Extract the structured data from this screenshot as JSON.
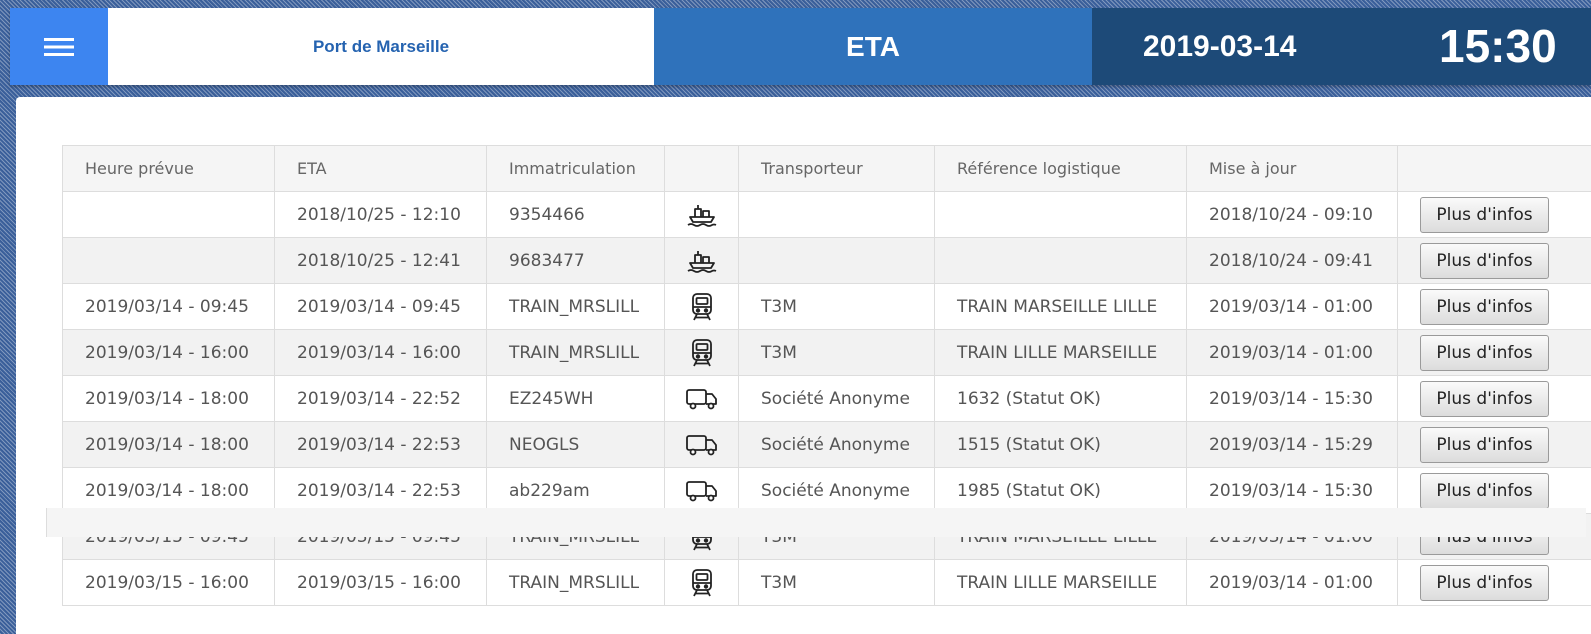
{
  "header": {
    "menu_icon": "hamburger-menu-icon",
    "site_name": "Port de Marseille",
    "module_title": "ETA",
    "date": "2019-03-14",
    "time": "15:30",
    "colors": {
      "menu": "#3d85f0",
      "module": "#2f72bb",
      "date": "#1d4a78"
    }
  },
  "table": {
    "columns": [
      "Heure prévue",
      "ETA",
      "Immatriculation",
      "",
      "Transporteur",
      "Référence logistique",
      "Mise à jour",
      ""
    ],
    "rows": [
      {
        "scheduled": "",
        "eta": "2018/10/25 - 12:10",
        "registration": "9354466",
        "icon": "ship-icon",
        "carrier": "",
        "reference": "",
        "updated": "2018/10/24 - 09:10",
        "button": "Plus d'infos"
      },
      {
        "scheduled": "",
        "eta": "2018/10/25 - 12:41",
        "registration": "9683477",
        "icon": "ship-icon",
        "carrier": "",
        "reference": "",
        "updated": "2018/10/24 - 09:41",
        "button": "Plus d'infos"
      },
      {
        "scheduled": "2019/03/14 - 09:45",
        "eta": "2019/03/14 - 09:45",
        "registration": "TRAIN_MRSLILL",
        "icon": "train-icon",
        "carrier": "T3M",
        "reference": "TRAIN MARSEILLE LILLE",
        "updated": "2019/03/14 - 01:00",
        "button": "Plus d'infos"
      },
      {
        "scheduled": "2019/03/14 - 16:00",
        "eta": "2019/03/14 - 16:00",
        "registration": "TRAIN_MRSLILL",
        "icon": "train-icon",
        "carrier": "T3M",
        "reference": "TRAIN LILLE MARSEILLE",
        "updated": "2019/03/14 - 01:00",
        "button": "Plus d'infos"
      },
      {
        "scheduled": "2019/03/14 - 18:00",
        "eta": "2019/03/14 - 22:52",
        "registration": "EZ245WH",
        "icon": "truck-icon",
        "carrier": "Société Anonyme",
        "reference": "1632 (Statut OK)",
        "updated": "2019/03/14 - 15:30",
        "button": "Plus d'infos"
      },
      {
        "scheduled": "2019/03/14 - 18:00",
        "eta": "2019/03/14 - 22:53",
        "registration": "NEOGLS",
        "icon": "truck-icon",
        "carrier": "Société Anonyme",
        "reference": "1515 (Statut OK)",
        "updated": "2019/03/14 - 15:29",
        "button": "Plus d'infos"
      },
      {
        "scheduled": "2019/03/14 - 18:00",
        "eta": "2019/03/14 - 22:53",
        "registration": "ab229am",
        "icon": "truck-icon",
        "carrier": "Société Anonyme",
        "reference": "1985 (Statut OK)",
        "updated": "2019/03/14 - 15:30",
        "button": "Plus d'infos"
      },
      {
        "scheduled": "2019/03/15 - 09:45",
        "eta": "2019/03/15 - 09:45",
        "registration": "TRAIN_MRSLILL",
        "icon": "train-icon",
        "carrier": "T3M",
        "reference": "TRAIN MARSEILLE LILLE",
        "updated": "2019/03/14 - 01:00",
        "button": "Plus d'infos"
      },
      {
        "scheduled": "2019/03/15 - 16:00",
        "eta": "2019/03/15 - 16:00",
        "registration": "TRAIN_MRSLILL",
        "icon": "train-icon",
        "carrier": "T3M",
        "reference": "TRAIN LILLE MARSEILLE",
        "updated": "2019/03/14 - 01:00",
        "button": "Plus d'infos"
      }
    ]
  }
}
